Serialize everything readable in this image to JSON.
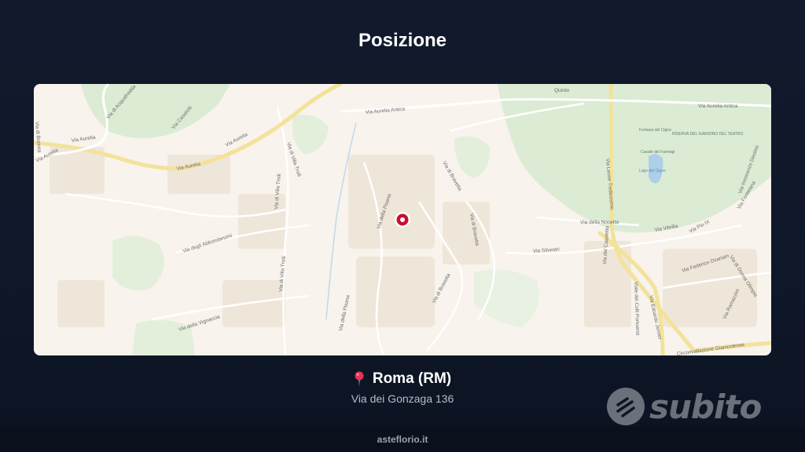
{
  "header": {
    "title": "Posizione"
  },
  "map": {
    "street_labels": {
      "via_aurelia_1": "Via Aurelia",
      "via_aurelia_2": "Via Aurelia",
      "via_aurelia_3": "Via Aurelia",
      "via_aurelia_4": "Via Aurelia",
      "via_aurelia_antica": "Via Aurelia Antica",
      "via_aurelia_antica_2": "Via Aurelia Antica",
      "via_della_pisana_1": "Via della Pisana",
      "via_della_pisana_2": "Via della Pisana",
      "via_di_bravetta_1": "Via di Bravetta",
      "via_di_bravetta_2": "Via di Bravetta",
      "via_di_bravetta_3": "Via di Bravetta",
      "via_silvestri": "Via Silvestri",
      "via_della_nocetta": "Via della Nocetta",
      "via_leone_tredicesimo": "Via Leone Tredicesimo",
      "viale_dei_colli_portuensi": "Viale dei Colli Portuensi",
      "via_del_casaletto": "Via del Casaletto",
      "circonvallazione_gianicolense": "Circonvallazione Gianicolense",
      "via_di_villa_troili_1": "Via di Villa Troili",
      "via_di_villa_troili_2": "Via di Villa Troili",
      "via_di_villa_troili_3": "Via di Villa Troili",
      "via_degli_abbondanzini": "Via degli Abbondanzini",
      "via_della_vignaccia": "Via della Vignaccia",
      "via_di_acquafredda": "Via di Acquafredda",
      "via_di_boccea": "Via di Boccea",
      "via_casalotti": "Via Casalotti",
      "via_di_quinto": "Quinto",
      "via_vitellia": "Via Vitellia",
      "via_pio_ix": "Via Pio IX",
      "via_federico_ozanam": "Via Federico Ozanam",
      "via_donna_olimpia": "Via di Donna Olimpia",
      "via_edoardo_jenner": "Via Edoardo Jenner",
      "via_ramazzini": "Via Ramazzini",
      "via_fonteiana": "Via Fonteiana",
      "via_innocenzo_x": "Via Innocenzo Decimo"
    },
    "park_labels": {
      "fontana_cigno": "Fontana del Cigno",
      "casale_farmagi": "Casale del Farmagi",
      "teatro_label": "RISERVA DEL GIARDINO DEL TEATRO",
      "lago_cigno": "Lago del Cigno"
    },
    "marker_icon": "location-marker-icon",
    "colors": {
      "background": "#f8f3ec",
      "park": "#d9ead3",
      "major_road": "#f5e59a",
      "water": "#a9cde8",
      "marker": "#c8102e"
    }
  },
  "location": {
    "pin_icon": "map-pin-icon",
    "city": "Roma (RM)",
    "address": "Via dei Gonzaga 136"
  },
  "brand": {
    "name": "subito"
  },
  "footer": {
    "site": "asteflorio.it"
  }
}
